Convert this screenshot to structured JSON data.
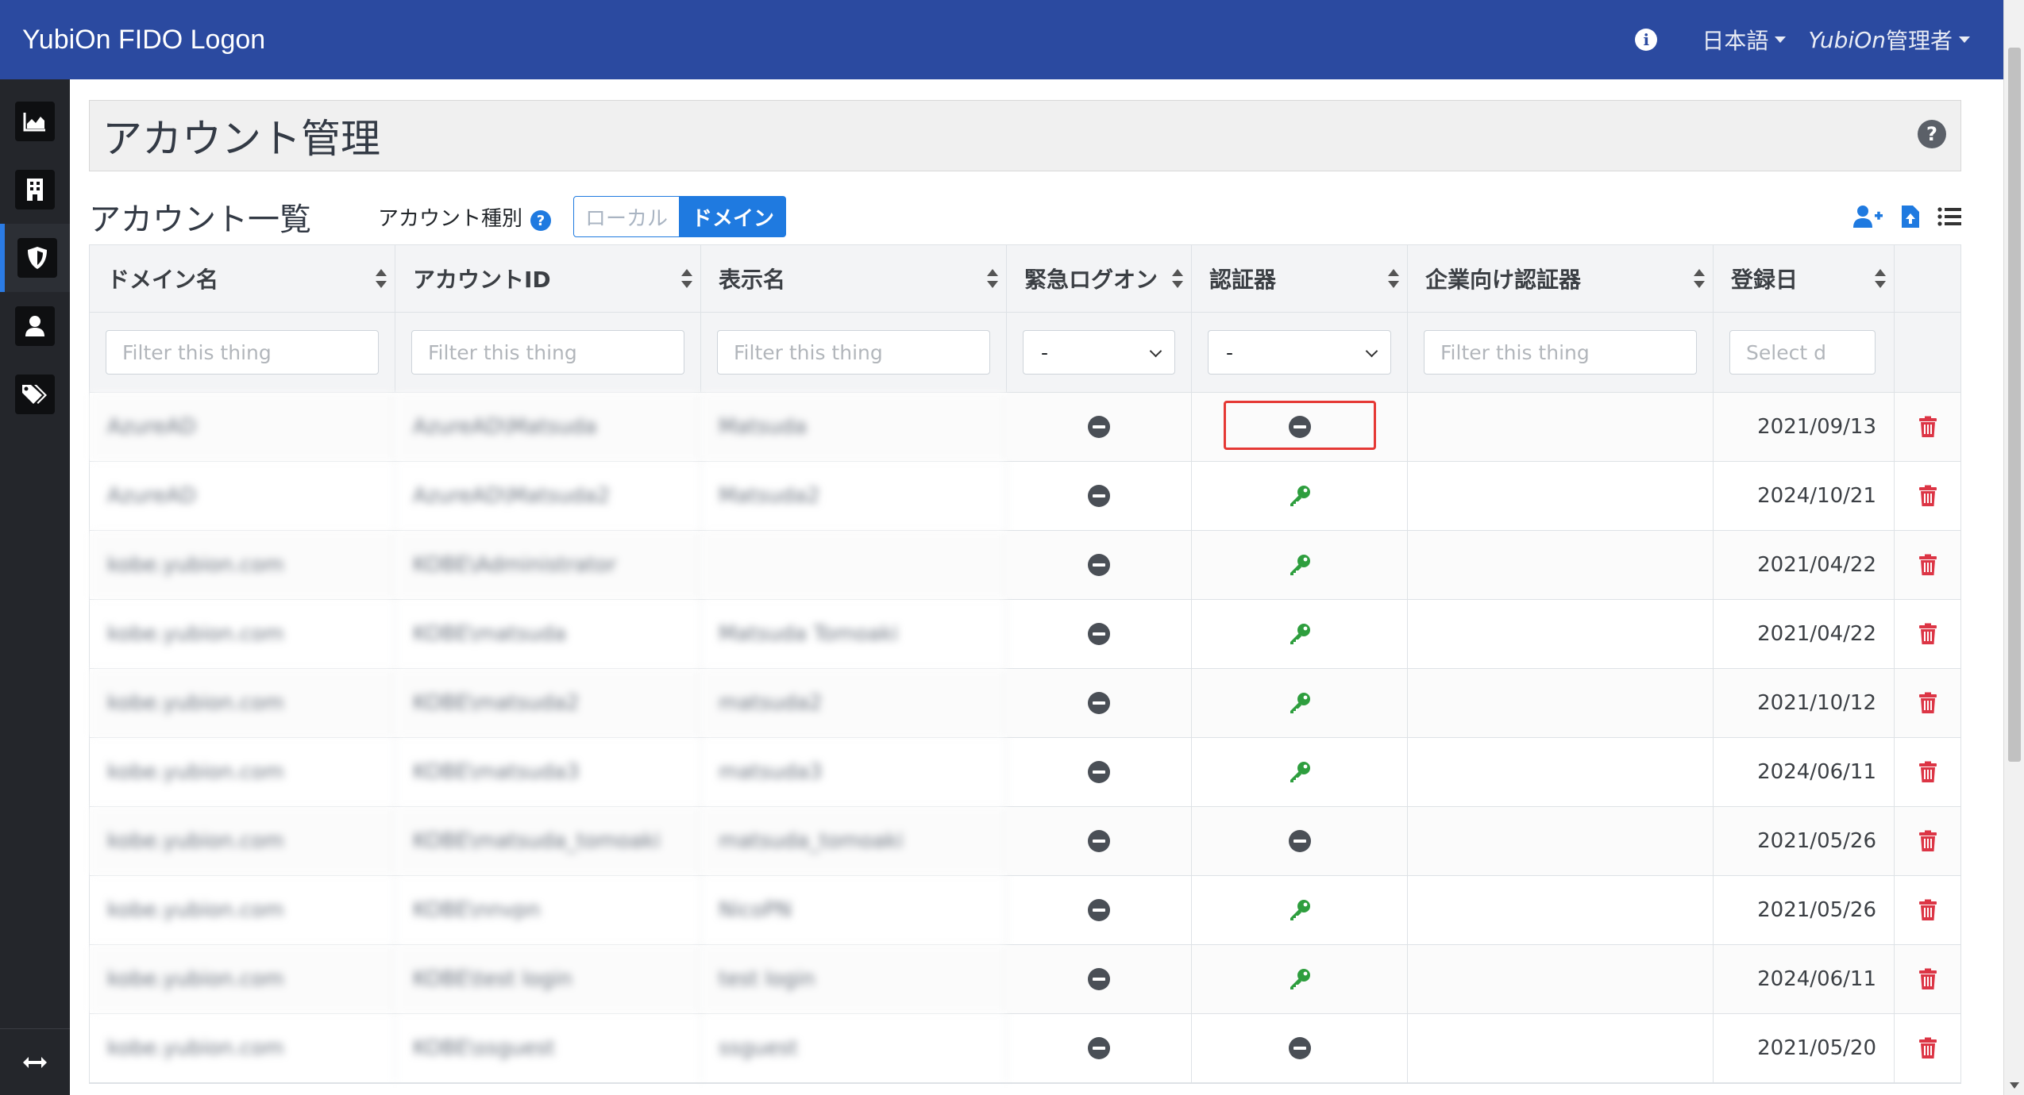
{
  "navbar": {
    "brand": "YubiOn FIDO Logon",
    "language": "日本語",
    "user_prefix": "YubiOn",
    "user_suffix": "管理者"
  },
  "page": {
    "title": "アカウント管理",
    "list_title": "アカウント一覧",
    "account_type_label": "アカウント種別",
    "toggle_local": "ローカル",
    "toggle_domain": "ドメイン",
    "toggle_selected": "ドメイン"
  },
  "table": {
    "headers": [
      "ドメイン名",
      "アカウントID",
      "表示名",
      "緊急ログオン",
      "認証器",
      "企業向け認証器",
      "登録日"
    ],
    "filter_placeholder": "Filter this thing",
    "select_default": "-",
    "date_placeholder": "Select d",
    "rows": [
      {
        "domain": "AzureAD",
        "account_id": "AzureAD\\Matsuda",
        "display": "Matsuda",
        "emergency": "minus",
        "authenticator": "minus",
        "date": "2021/09/13"
      },
      {
        "domain": "AzureAD",
        "account_id": "AzureAD\\Matsuda2",
        "display": "Matsuda2",
        "emergency": "minus",
        "authenticator": "key",
        "date": "2024/10/21"
      },
      {
        "domain": "kobe.yubion.com",
        "account_id": "KOBE\\Administrator",
        "display": "",
        "emergency": "minus",
        "authenticator": "key",
        "date": "2021/04/22"
      },
      {
        "domain": "kobe.yubion.com",
        "account_id": "KOBE\\matsuda",
        "display": "Matsuda Tomoaki",
        "emergency": "minus",
        "authenticator": "key",
        "date": "2021/04/22"
      },
      {
        "domain": "kobe.yubion.com",
        "account_id": "KOBE\\matsuda2",
        "display": "matsuda2",
        "emergency": "minus",
        "authenticator": "key",
        "date": "2021/10/12"
      },
      {
        "domain": "kobe.yubion.com",
        "account_id": "KOBE\\matsuda3",
        "display": "matsuda3",
        "emergency": "minus",
        "authenticator": "key",
        "date": "2024/06/11"
      },
      {
        "domain": "kobe.yubion.com",
        "account_id": "KOBE\\matsuda_tomoaki",
        "display": "matsuda_tomoaki",
        "emergency": "minus",
        "authenticator": "minus",
        "date": "2021/05/26"
      },
      {
        "domain": "kobe.yubion.com",
        "account_id": "KOBE\\nnvpn",
        "display": "NicoPN",
        "emergency": "minus",
        "authenticator": "key",
        "date": "2021/05/26"
      },
      {
        "domain": "kobe.yubion.com",
        "account_id": "KOBE\\test login",
        "display": "test login",
        "emergency": "minus",
        "authenticator": "key",
        "date": "2024/06/11"
      },
      {
        "domain": "kobe.yubion.com",
        "account_id": "KOBE\\ssguest",
        "display": "ssguest",
        "emergency": "minus",
        "authenticator": "minus",
        "date": "2021/05/20"
      }
    ]
  },
  "colors": {
    "navbar": "#2b4aa0",
    "sidebar": "#24262b",
    "accent": "#1f7ae0",
    "key_green": "#2e9e3e",
    "delete_red": "#dc3545"
  },
  "icons": [
    "info-icon",
    "chart-icon",
    "building-icon",
    "shield-icon",
    "user-icon",
    "tags-icon",
    "expand-icon",
    "help-icon",
    "user-plus-icon",
    "file-upload-icon",
    "list-icon",
    "minus-circle-icon",
    "key-icon",
    "trash-icon"
  ]
}
